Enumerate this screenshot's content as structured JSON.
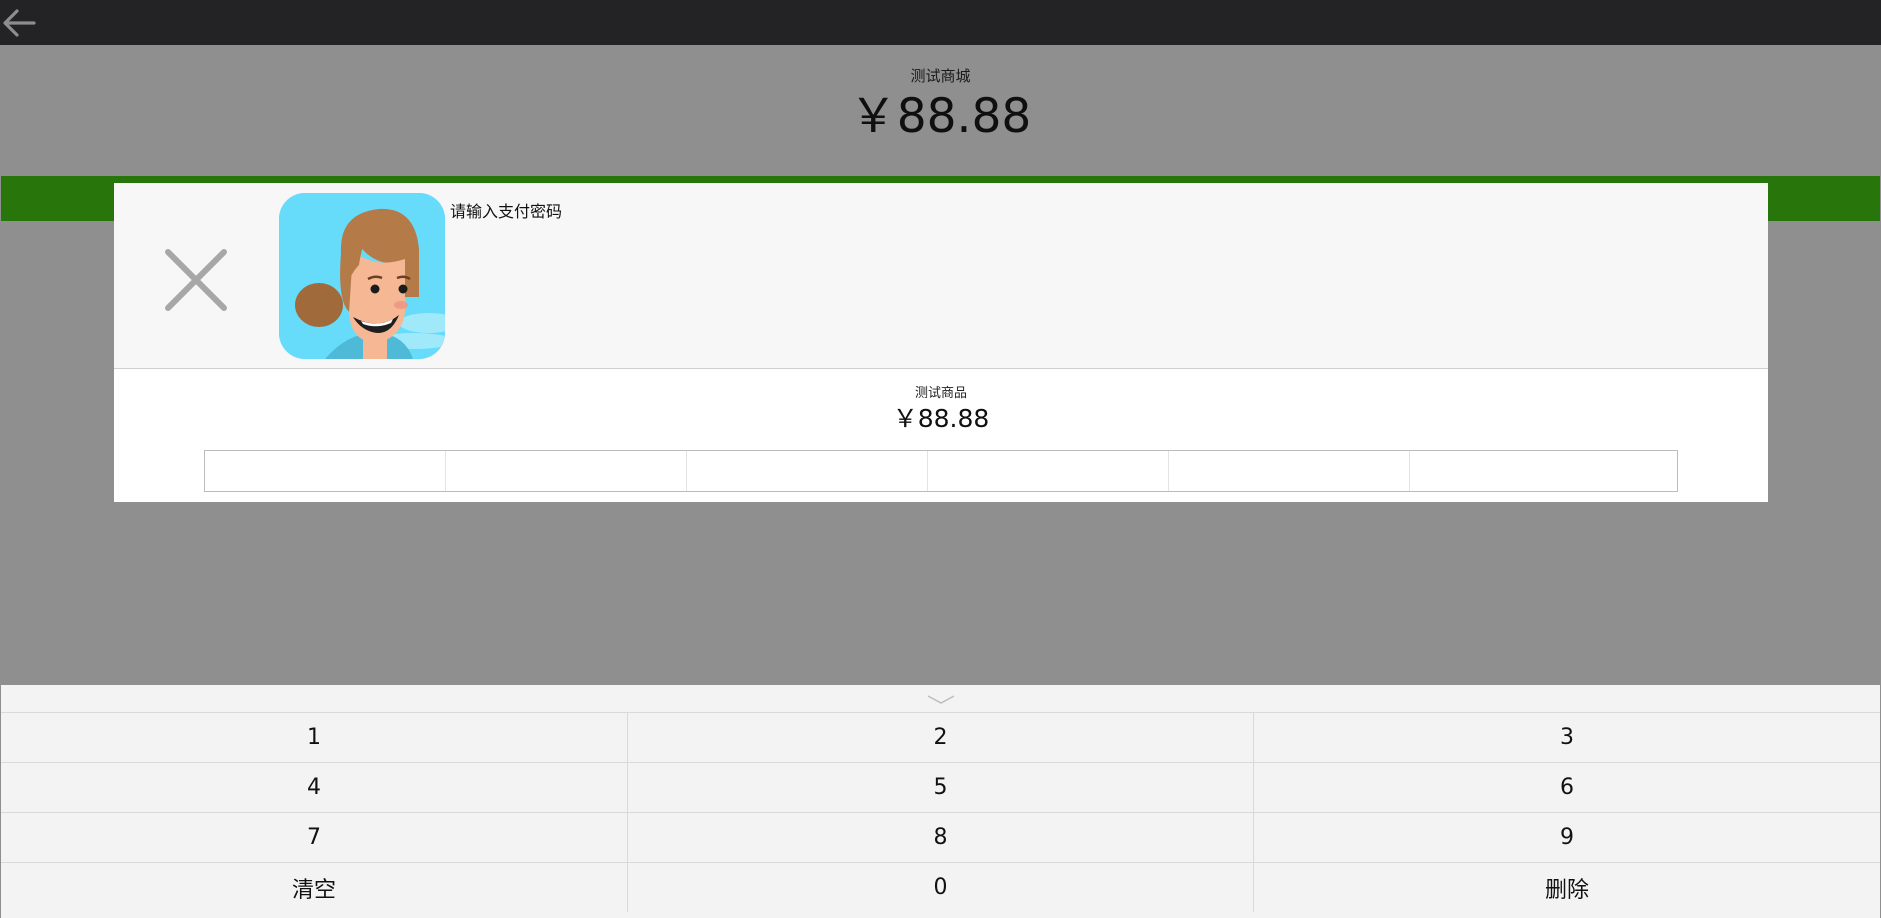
{
  "nav": {
    "back_icon": "arrow-left-icon"
  },
  "header": {
    "store_name": "测试商城",
    "amount": "￥88.88"
  },
  "dialog": {
    "close_icon": "close-icon",
    "avatar_icon": "avatar-icon",
    "prompt": "请输入支付密码",
    "product_name": "测试商品",
    "product_amount": "￥88.88",
    "password_digits": 6
  },
  "keypad": {
    "collapse_icon": "chevron-down-icon",
    "keys": [
      "1",
      "2",
      "3",
      "4",
      "5",
      "6",
      "7",
      "8",
      "9",
      "清空",
      "0",
      "删除"
    ]
  },
  "colors": {
    "topbar": "#232325",
    "overlay": "#8f8f90",
    "accent_green": "#27750b",
    "dialog_bg": "#f7f7f7",
    "keypad_bg": "#f3f3f3"
  }
}
